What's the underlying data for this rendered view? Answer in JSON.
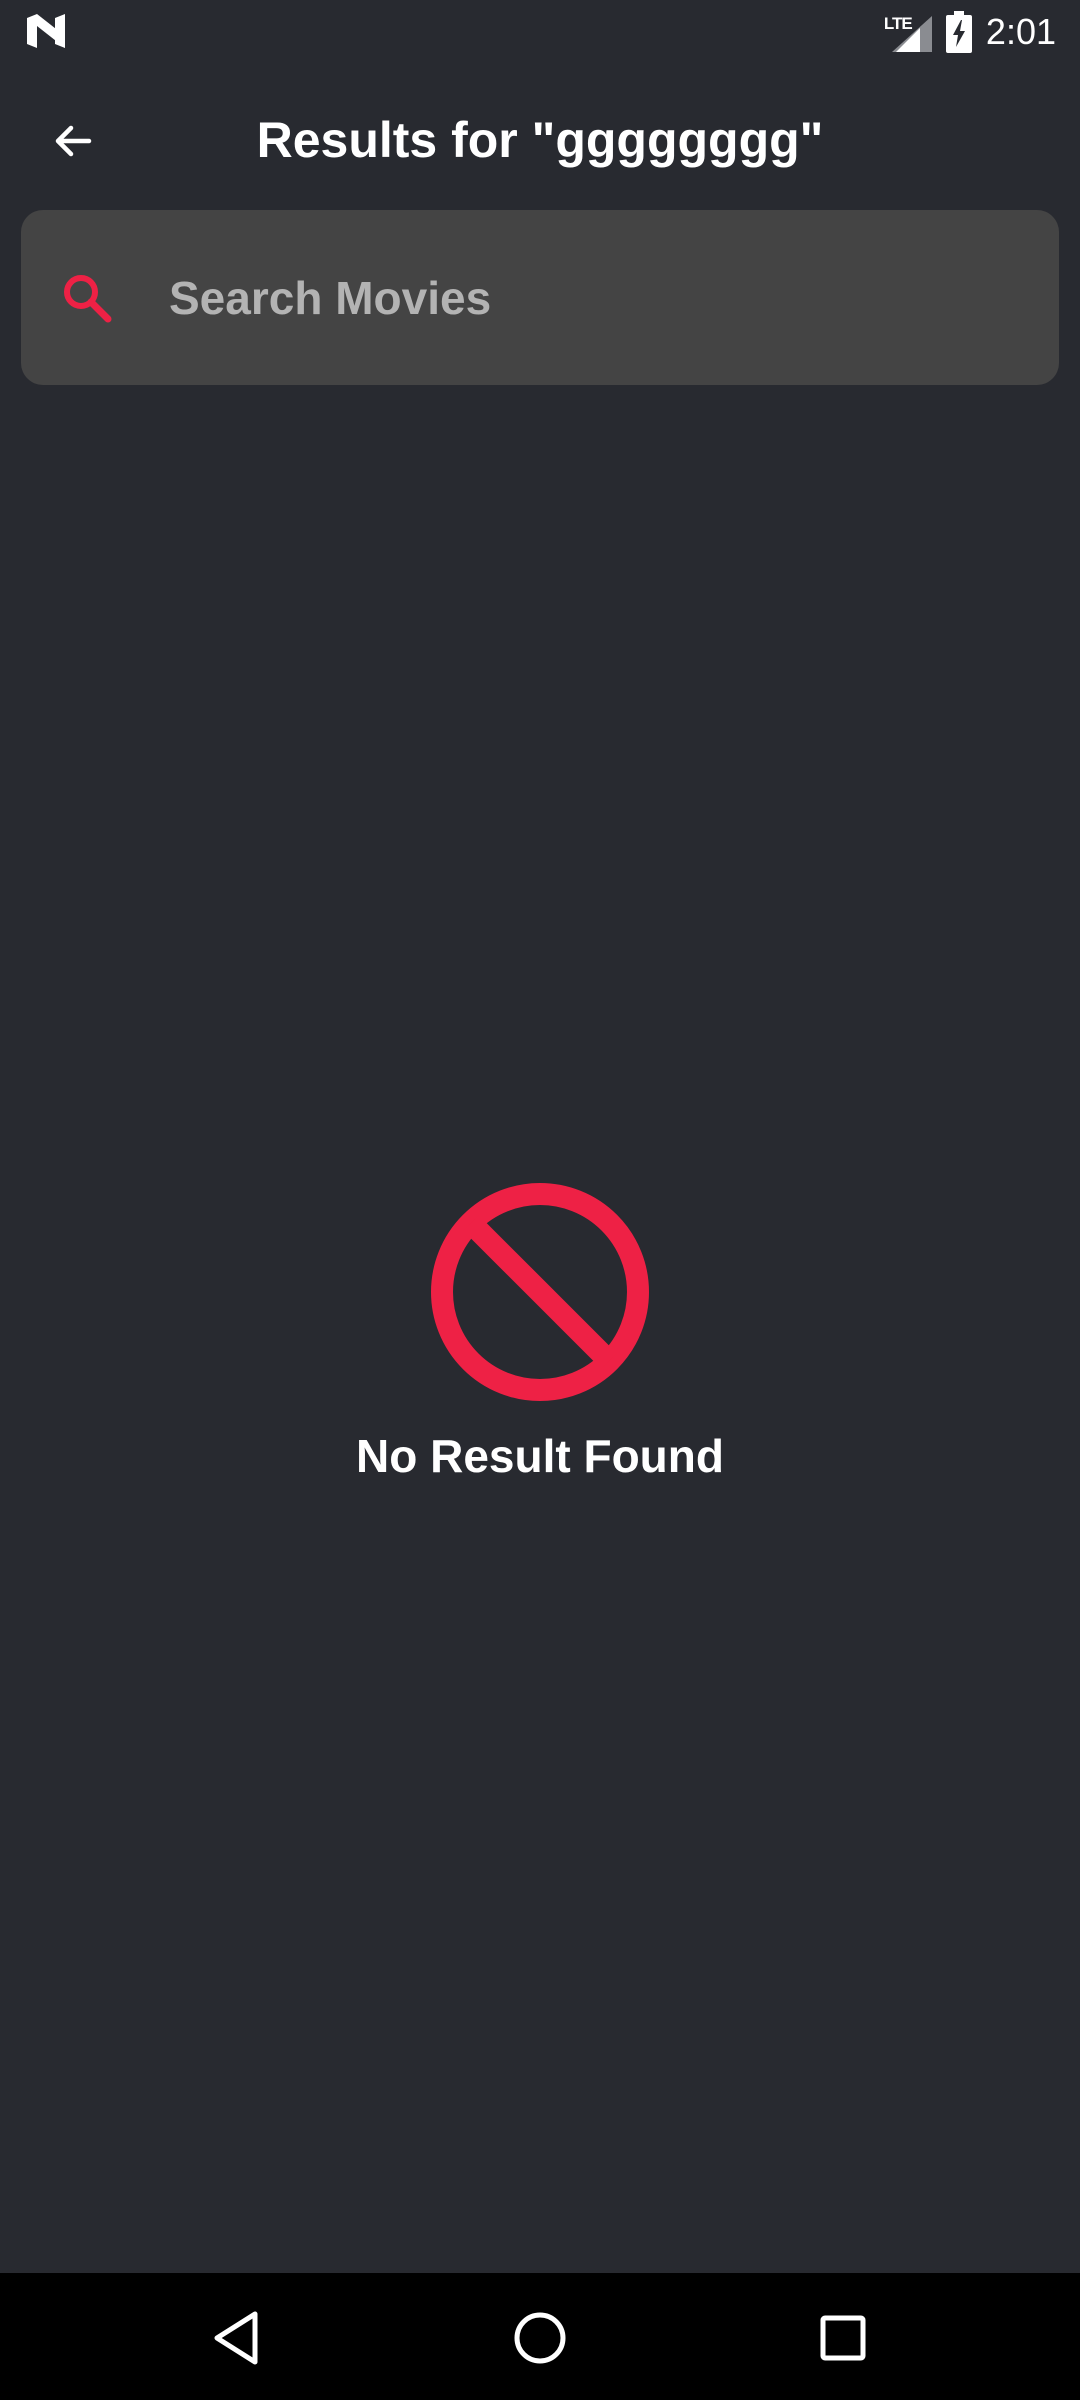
{
  "status_bar": {
    "left_icon": "n-logo-icon",
    "network_label": "LTE",
    "signal_icon": "cell-signal-icon",
    "battery_icon": "battery-charging-icon",
    "time": "2:01"
  },
  "app_bar": {
    "back_icon": "arrow-left-icon",
    "title": "Results for \"gggggggg\""
  },
  "search": {
    "icon": "search-icon",
    "value": "",
    "placeholder": "Search Movies"
  },
  "empty_state": {
    "icon": "no-entry-icon",
    "message": "No Result Found"
  },
  "nav_bar": {
    "back_icon": "triangle-back-icon",
    "home_icon": "circle-home-icon",
    "recents_icon": "square-recents-icon"
  },
  "colors": {
    "background": "#282A30",
    "search_background": "#444444",
    "accent": "#EE2145",
    "text_primary": "#FFFFFF",
    "text_placeholder": "#B3B3B3",
    "nav_background": "#000000"
  }
}
